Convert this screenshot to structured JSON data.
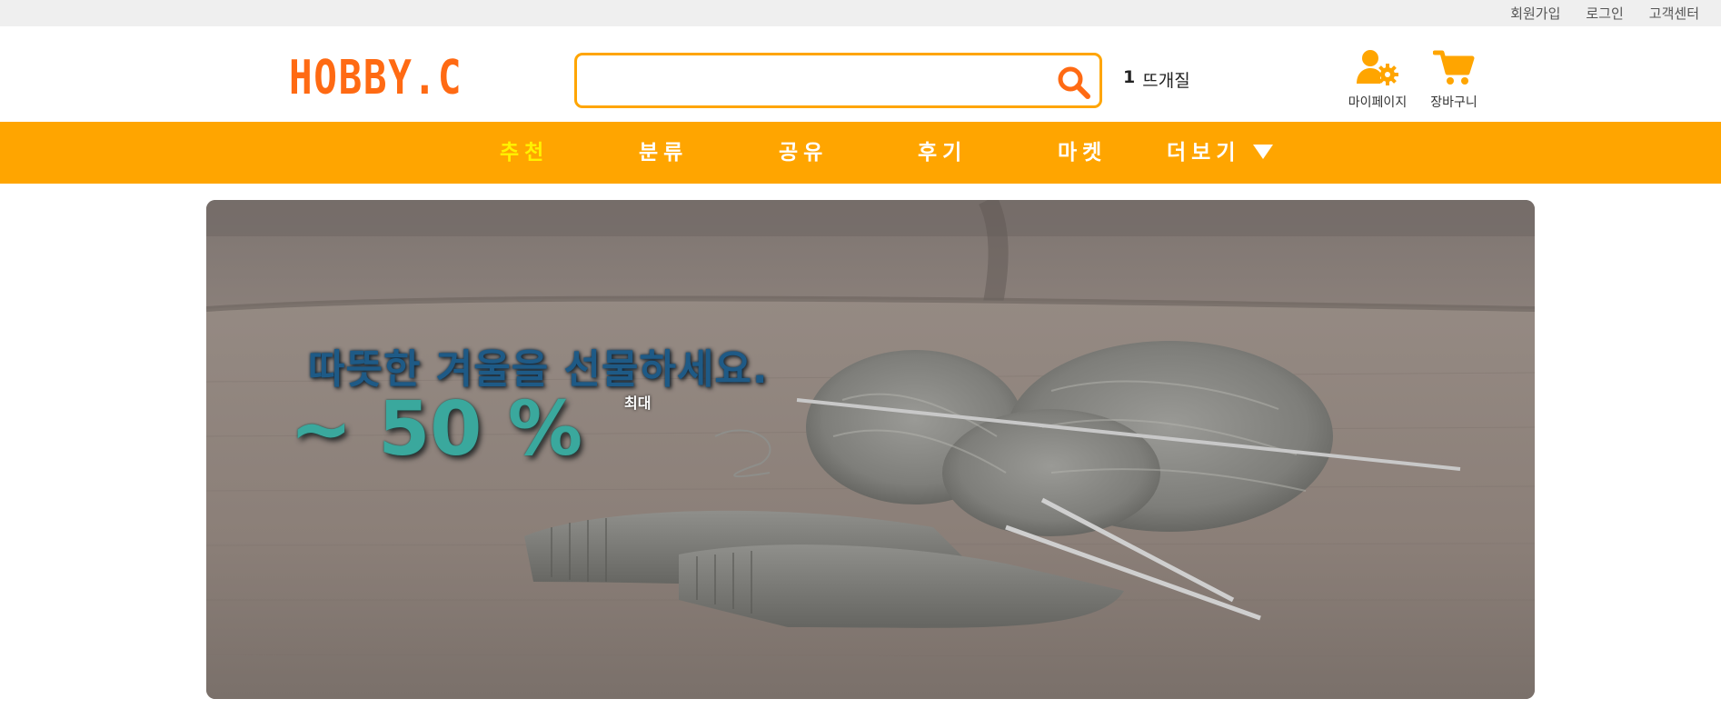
{
  "top_links": [
    "회원가입",
    "로그인",
    "고객센터"
  ],
  "logo": {
    "text": "HOBBY.C"
  },
  "search": {
    "value": "",
    "placeholder": ""
  },
  "trending": {
    "rank": "1",
    "term": "뜨개질"
  },
  "header_buttons": {
    "mypage_label": "마이페이지",
    "cart_label": "장바구니"
  },
  "nav": {
    "items": [
      "추천",
      "분류",
      "공유",
      "후기",
      "마켓",
      "더보기"
    ],
    "active": "추천"
  },
  "banner": {
    "headline": "따뜻한 겨울을 선물하세요.",
    "discount": "~ 50 %",
    "max_label": "최대"
  },
  "colors": {
    "brand": "#ff6a13",
    "accent": "#ffa500",
    "active_nav": "#fff200",
    "discount": "#3aa89d",
    "headline": "#1e5a86"
  },
  "icons": {
    "search": "search-icon",
    "mypage": "user-gear-icon",
    "cart": "cart-icon",
    "more": "caret-down-icon"
  }
}
